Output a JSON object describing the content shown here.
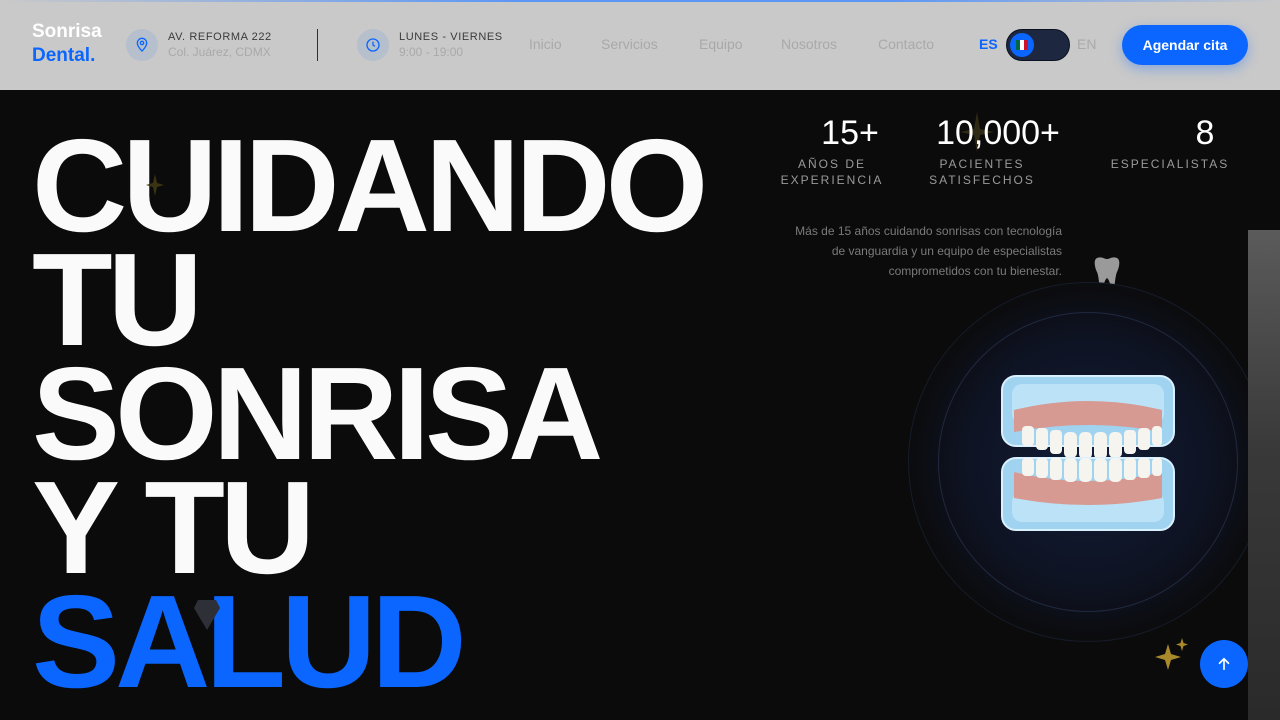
{
  "brand": {
    "line1": "Sonrisa",
    "line2": "Dental."
  },
  "address": {
    "label": "AV. REFORMA 222",
    "sub": "Col. Juárez, CDMX",
    "icon": "location-pin-icon"
  },
  "hours": {
    "label": "LUNES - VIERNES",
    "sub": "9:00 - 19:00",
    "icon": "clock-icon"
  },
  "nav": {
    "items": [
      "Inicio",
      "Servicios",
      "Equipo",
      "Nosotros",
      "Contacto"
    ]
  },
  "language": {
    "es": "ES",
    "en": "EN",
    "active": "ES"
  },
  "cta": {
    "label": "Agendar cita"
  },
  "hero": {
    "lines": [
      "CUIDANDO",
      "TU",
      "SONRISA",
      "Y TU"
    ],
    "accent": "SALUD"
  },
  "stats": [
    {
      "value": "15+",
      "label_line1": "AÑOS DE",
      "label_line2": "EXPERIENCIA"
    },
    {
      "value": "10,000+",
      "label_line1": "PACIENTES",
      "label_line2": "SATISFECHOS"
    },
    {
      "value": "8",
      "label_line1": "ESPECIALISTAS",
      "label_line2": ""
    }
  ],
  "description": "Más de 15 años cuidando sonrisas con tecnología de vanguardia y un equipo de especialistas comprometidos con tu bienestar.",
  "colors": {
    "accent": "#0a66ff",
    "background": "#0b0b0c",
    "header": "#c9c9c9",
    "text": "#fafafa"
  },
  "icons": {
    "scroll_top": "arrow-up-icon",
    "tooth": "tooth-icon",
    "sparkles": "sparkles-icon",
    "diamond": "diamond-icon",
    "denture": "denture-model-image"
  }
}
